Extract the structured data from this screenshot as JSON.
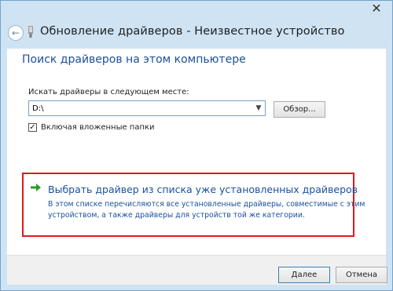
{
  "window": {
    "close_glyph": "✕",
    "back_glyph": "←",
    "title": "Обновление драйверов - Неизвестное устройство"
  },
  "main": {
    "heading": "Поиск драйверов на этом компьютере",
    "path_label": "Искать драйверы в следующем месте:",
    "path_value": "D:\\",
    "browse_label": "Обзор...",
    "include_subfolders": {
      "label": "Включая вложенные папки",
      "checked": true,
      "check_glyph": "✓"
    },
    "pick_option": {
      "link": "Выбрать драйвер из списка уже установленных драйверов",
      "description_lines": [
        "В этом списке перечисляются все установленные драйверы, совместимые с этим",
        "устройством, а также драйверы для устройств той же категории."
      ],
      "highlight_color": "#e0171b",
      "arrow_color": "#2e9a2e"
    }
  },
  "footer": {
    "next_label": "Далее",
    "cancel_label": "Отмена"
  },
  "colors": {
    "frame": "#cfe3f3",
    "link_blue": "#1a4f9c"
  }
}
